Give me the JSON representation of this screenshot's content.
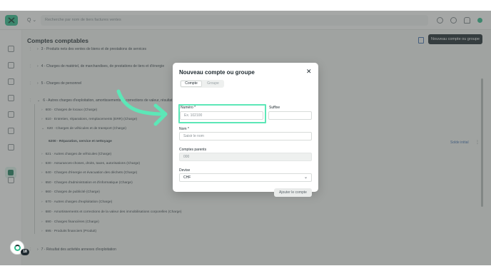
{
  "header": {
    "logo_text": "",
    "search_prefix": "Q",
    "search_placeholder": "Recherche par nom de tiers factures ventes"
  },
  "page": {
    "title": "Comptes comptables",
    "new_button": "Nouveau compte ou groupe",
    "solde_initial": "Solde initial",
    "rows": [
      "3 - Produits nets des ventes de biens et de prestations de services",
      "4 - Charges de matériel, de marchandises, de prestations de tiers et d'énergie",
      "5 - Charges de personnel",
      "6 - Autres charges d'exploitation, amortissements et corrections de valeur, résultat financier",
      "7 - Résultat des activités annexes d'exploitation"
    ],
    "sub_items": [
      "600 · Charges de locaux (Charge)",
      "610 · Entretien, réparations, remplacements (ERR) (Charge)",
      "620 · Charges de véhicules et de transport (Charge)",
      "621 · Autres charges de véhicules (Charge)",
      "630 · Assurances-choses, droits, taxes, autorisations (Charge)",
      "640 · Charges d'énergie et évacuation des déchets (Charge)",
      "650 · Charges d'administration et d'informatique (Charge)",
      "660 · Charges de publicité (Charge)",
      "670 · Autres charges d'exploitation (Charge)",
      "680 · Amortissements et corrections de la valeur des immobilisations corporelles (Charge)",
      "690 · Charges financières (Charge)",
      "695 · Produits financiers (Produit)"
    ],
    "nested_item": "6200 - Réparation, service et nettoyage"
  },
  "support": {
    "badge": "18"
  },
  "modal": {
    "title": "Nouveau compte ou groupe",
    "close_glyph": "✕",
    "tab_account": "Compte",
    "tab_group": "Groupe",
    "numero_label": "Numéro *",
    "numero_placeholder": "Ex. 102100",
    "suffixe_label": "Suffixe",
    "nom_label": "Nom *",
    "nom_placeholder": "Saisir le nom",
    "parents_label": "Comptes parents",
    "parents_value": "000",
    "devise_label": "Devise",
    "devise_value": "CHF",
    "submit": "Ajouter le compte"
  },
  "colors": {
    "accent": "#2fbf8f",
    "highlight": "#5ce7b7",
    "dark": "#1f2a30"
  }
}
